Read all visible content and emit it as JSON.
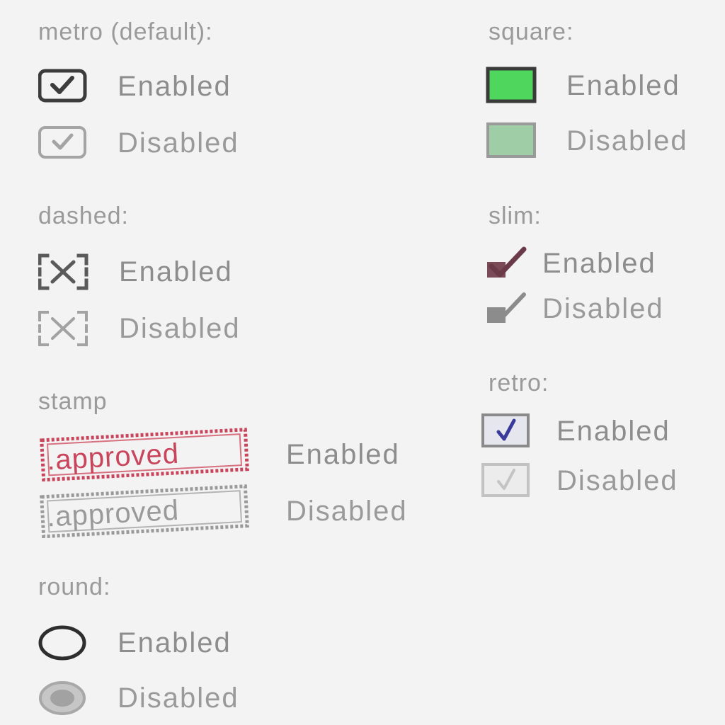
{
  "sections": {
    "metro": {
      "title": "metro (default):",
      "enabled_label": "Enabled",
      "disabled_label": "Disabled",
      "enabled_checked": true,
      "disabled_checked": true
    },
    "square": {
      "title": "square:",
      "enabled_label": "Enabled",
      "disabled_label": "Disabled",
      "enabled_color": "#4fd65c",
      "disabled_color": "#9fcea6",
      "enabled_checked": true,
      "disabled_checked": true
    },
    "dashed": {
      "title": "dashed:",
      "enabled_label": "Enabled",
      "disabled_label": "Disabled",
      "enabled_checked": true,
      "disabled_checked": true
    },
    "slim": {
      "title": "slim:",
      "enabled_label": "Enabled",
      "disabled_label": "Disabled",
      "enabled_checked": true,
      "disabled_checked": true
    },
    "stamp": {
      "title": "stamp",
      "stamp_text": ".approved",
      "enabled_label": "Enabled",
      "disabled_label": "Disabled",
      "enabled_color": "#c8455c",
      "disabled_color": "#9a9a9a",
      "enabled_checked": true,
      "disabled_checked": true
    },
    "retro": {
      "title": "retro:",
      "enabled_label": "Enabled",
      "disabled_label": "Disabled",
      "enabled_checked": true,
      "disabled_checked": true
    },
    "round": {
      "title": "round:",
      "enabled_label": "Enabled",
      "disabled_label": "Disabled",
      "enabled_checked": false,
      "disabled_checked": true
    }
  }
}
